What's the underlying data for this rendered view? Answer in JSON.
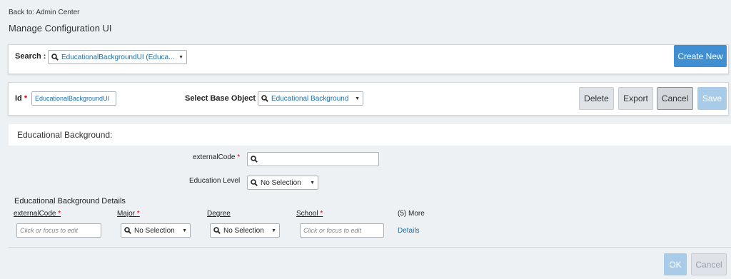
{
  "nav": {
    "back_link": "Back to: Admin Center"
  },
  "page": {
    "title": "Manage Configuration UI"
  },
  "search": {
    "label": "Search :",
    "value": "EducationalBackgroundUI (Educa...",
    "create_new_label": "Create New"
  },
  "config": {
    "id_label": "Id",
    "required_mark": "*",
    "id_value": "EducationalBackgroundUI",
    "base_object_label": "Select Base Object",
    "base_object_value": "Educational Background",
    "buttons": {
      "delete": "Delete",
      "export": "Export",
      "cancel": "Cancel",
      "save": "Save"
    }
  },
  "form": {
    "section_title": "Educational Background:",
    "external_code_label": "externalCode",
    "education_level_label": "Education Level",
    "education_level_value": "No Selection"
  },
  "details": {
    "title": "Educational Background Details",
    "columns": {
      "external_code": "externalCode",
      "major": "Major",
      "degree": "Degree",
      "school": "School",
      "more": "(5) More"
    },
    "row": {
      "external_code_placeholder": "Click or focus to edit",
      "major_value": "No Selection",
      "degree_value": "No Selection",
      "school_placeholder": "Click or focus to edit",
      "details_link": "Details"
    }
  },
  "footer": {
    "ok": "OK",
    "cancel": "Cancel"
  },
  "icons": {
    "search": "search-icon",
    "dropdown": "chevron-down-icon"
  },
  "colors": {
    "accent": "#3f8fd2",
    "link": "#1a6ea8",
    "required": "#d0021b"
  }
}
